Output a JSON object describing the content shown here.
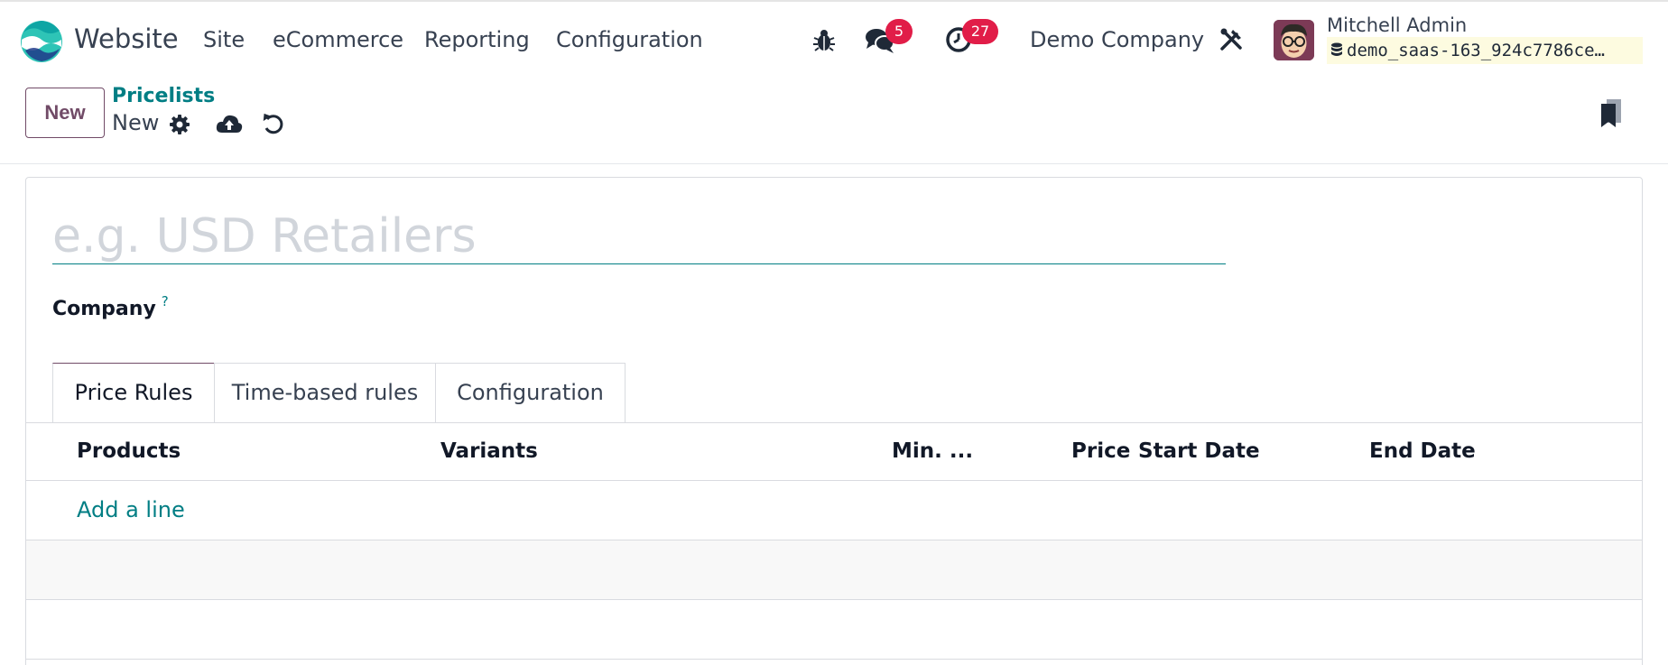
{
  "navbar": {
    "app_name": "Website",
    "menu": [
      "Site",
      "eCommerce",
      "Reporting",
      "Configuration"
    ],
    "messages_count": "5",
    "activities_count": "27",
    "company": "Demo Company",
    "user_name": "Mitchell Admin",
    "database": "demo_saas-163_924c7786ce…",
    "icons": [
      "debug-icon",
      "chat-icon",
      "clock-icon",
      "tools-icon",
      "database-icon"
    ],
    "badge_color": "#e11d48"
  },
  "control_panel": {
    "new_button": "New",
    "breadcrumb": "Pricelists",
    "record_name": "New",
    "icons": [
      "gear-icon",
      "cloud-upload-icon",
      "undo-icon",
      "bookmark-icon"
    ]
  },
  "form": {
    "name_placeholder": "e.g. USD Retailers",
    "company_label": "Company",
    "help_mark": "?"
  },
  "tabs": [
    {
      "label": "Price Rules",
      "active": true
    },
    {
      "label": "Time-based rules",
      "active": false
    },
    {
      "label": "Configuration",
      "active": false
    }
  ],
  "table": {
    "columns": [
      "Products",
      "Variants",
      "Min. ...",
      "Price",
      "Start Date",
      "End Date"
    ],
    "add_line": "Add a line"
  },
  "colors": {
    "primary": "#714b67",
    "link": "#017e84"
  }
}
